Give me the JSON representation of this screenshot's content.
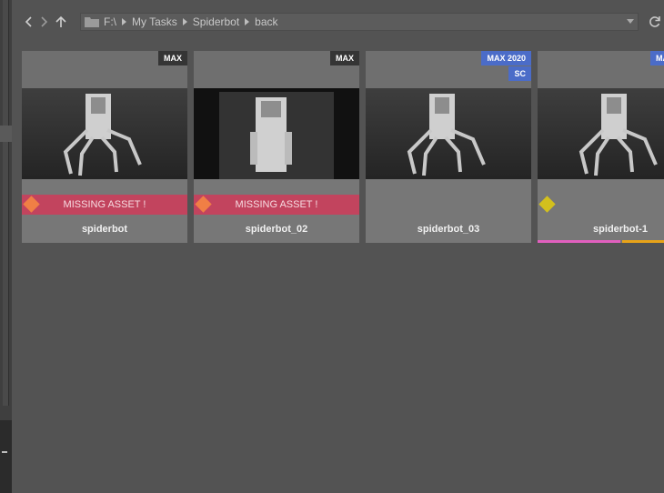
{
  "toolbar": {
    "back_icon": "chevron-left-icon",
    "forward_icon": "chevron-right-icon",
    "up_icon": "arrow-up-icon",
    "breadcrumbs": [
      "F:\\",
      "My Tasks",
      "Spiderbot",
      "back"
    ],
    "refresh_icon": "refresh-icon"
  },
  "assets": [
    {
      "name": "spiderbot",
      "badges": [
        "MAX"
      ],
      "badge_color": "#353535",
      "warning": "MISSING ASSET !",
      "status_diamond": "#f07f45"
    },
    {
      "name": "spiderbot_02",
      "badges": [
        "MAX"
      ],
      "badge_color": "#353535",
      "warning": "MISSING ASSET !",
      "status_diamond": "#f07f45"
    },
    {
      "name": "spiderbot_03",
      "badges": [
        "MAX 2020",
        "SC"
      ],
      "badge_color": "#4b6cc8",
      "warning": "",
      "status_diamond": ""
    },
    {
      "name": "spiderbot-1",
      "badges": [
        "MAX"
      ],
      "badge_color": "#4b6cc8",
      "warning": "",
      "status_diamond": "#d3c01d",
      "tag_colors": [
        "#e15fbe",
        "#e8a318"
      ]
    }
  ],
  "colors": {
    "background": "#535353",
    "card": "#777777",
    "warning_bar": "#c2445e"
  }
}
